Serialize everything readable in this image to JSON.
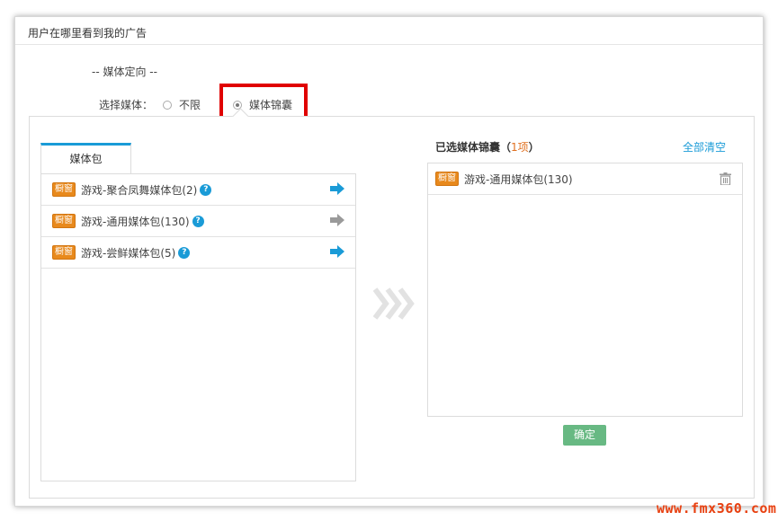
{
  "window": {
    "title": "用户在哪里看到我的广告"
  },
  "targeting": {
    "section_title": "-- 媒体定向 --",
    "choose_label": "选择媒体：",
    "options": [
      {
        "label": "不限",
        "selected": false
      },
      {
        "label": "媒体锦囊",
        "selected": true
      }
    ]
  },
  "left_panel": {
    "tab_label": "媒体包",
    "items": [
      {
        "tag": "橱窗",
        "label": "游戏-聚合凤舞媒体包(2)",
        "help": "?",
        "added": false
      },
      {
        "tag": "橱窗",
        "label": "游戏-通用媒体包(130)",
        "help": "?",
        "added": true
      },
      {
        "tag": "橱窗",
        "label": "游戏-尝鲜媒体包(5)",
        "help": "?",
        "added": false
      }
    ]
  },
  "right_panel": {
    "title": "已选媒体锦囊",
    "count_open": "（",
    "count": "1项",
    "count_close": "）",
    "clear_all": "全部清空",
    "items": [
      {
        "tag": "橱窗",
        "label": "游戏-通用媒体包(130)"
      }
    ],
    "confirm_label": "确定"
  },
  "watermark": "www.fmx360.com",
  "colors": {
    "accent_blue": "#1a9bd7",
    "tag_orange": "#e8891c",
    "confirm_green": "#68b983",
    "highlight_red": "#e00000",
    "arrow_inactive": "#9a9a9a"
  }
}
